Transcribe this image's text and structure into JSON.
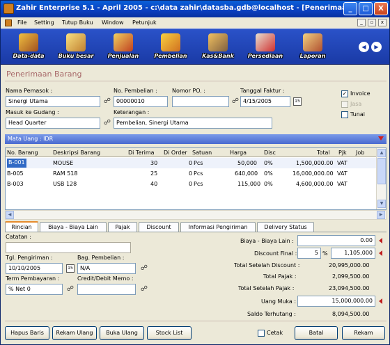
{
  "window": {
    "title": "Zahir Enterprise 5.1 - April 2005 - c:\\data zahir\\datasba.gdb@localhost - [Penerimaa..."
  },
  "titlebar_buttons": {
    "minimize": "_",
    "maximize": "□",
    "close": "X"
  },
  "menu": [
    "File",
    "Setting",
    "Tutup Buku",
    "Window",
    "Petunjuk"
  ],
  "mdi_controls": {
    "minimize": "_",
    "restore": "▫",
    "close": "x"
  },
  "toolbar": {
    "items": [
      "Data-data",
      "Buku besar",
      "Penjualan",
      "Pembelian",
      "Kas&Bank",
      "Persediaan",
      "Laporan"
    ],
    "prev": "◀",
    "next": "▶"
  },
  "form": {
    "heading": "Penerimaan Barang",
    "nama_pemasok": {
      "label": "Nama Pemasok :",
      "value": "Sinergi Utama"
    },
    "no_pembelian": {
      "label": "No. Pembelian :",
      "value": "00000010"
    },
    "nomor_po": {
      "label": "Nomor PO. :",
      "value": ""
    },
    "tanggal_faktur": {
      "label": "Tanggal Faktur :",
      "value": "4/15/2005"
    },
    "masuk_ke_gudang": {
      "label": "Masuk ke Gudang :",
      "value": "Head Quarter"
    },
    "keterangan": {
      "label": "Keterangan :",
      "value": "Pembelian, Sinergi Utama"
    },
    "checks": {
      "invoice": {
        "label": "Invoice",
        "checked": true
      },
      "jasa": {
        "label": "Jasa",
        "checked": false
      },
      "tunai": {
        "label": "Tunai",
        "checked": false
      }
    },
    "cal_label": "15",
    "lookup_glyph": "☍"
  },
  "currency_bar": "Mata Uang : IDR",
  "grid": {
    "columns": [
      "No. Barang",
      "Deskripsi Barang",
      "Di Terima",
      "Di Order",
      "Satuan",
      "Harga",
      "Disc",
      "Total",
      "Pjk",
      "Job"
    ],
    "rows": [
      [
        "B-001",
        "MOUSE",
        "30",
        "0",
        "Pcs",
        "50,000",
        "0%",
        "1,500,000.00",
        "VAT",
        ""
      ],
      [
        "B-005",
        "RAM 518",
        "25",
        "0",
        "Pcs",
        "640,000",
        "0%",
        "16,000,000.00",
        "VAT",
        ""
      ],
      [
        "B-003",
        "USB 128",
        "40",
        "0",
        "Pcs",
        "115,000",
        "0%",
        "4,600,000.00",
        "VAT",
        ""
      ]
    ]
  },
  "tabs": [
    "Rincian",
    "Biaya - Biaya Lain",
    "Pajak",
    "Discount",
    "Informasi Pengiriman",
    "Delivery Status"
  ],
  "rincian": {
    "catatan": {
      "label": "Catatan :",
      "value": ""
    },
    "tgl_pengiriman": {
      "label": "Tgl. Pengiriman :",
      "value": "10/10/2005"
    },
    "bag_pembelian": {
      "label": "Bag. Pembelian :",
      "value": "N/A"
    },
    "term": {
      "label": "Term Pembayaran :",
      "value": "%  Net 0"
    },
    "credit_debit": {
      "label": "Credit/Debit Memo :",
      "value": ""
    }
  },
  "summary": {
    "biaya_lain": {
      "label": "Biaya - Biaya Lain :",
      "value": "0.00"
    },
    "discount_final": {
      "label": "Discount Final :",
      "pct": "5",
      "pct_sign": "%",
      "value": "1,105,000"
    },
    "total_setelah_discount": {
      "label": "Total Setelah Discount :",
      "value": "20,995,000.00"
    },
    "total_pajak": {
      "label": "Total Pajak :",
      "value": "2,099,500.00"
    },
    "total_setelah_pajak": {
      "label": "Total Setelah Pajak :",
      "value": "23,094,500.00"
    },
    "uang_muka": {
      "label": "Uang Muka :",
      "value": "15,000,000.00"
    },
    "saldo_terhutang": {
      "label": "Saldo Terhutang :",
      "value": "8,094,500.00"
    }
  },
  "buttons": {
    "hapus_baris": "Hapus Baris",
    "rekam_ulang": "Rekam Ulang",
    "buka_ulang": "Buka Ulang",
    "stock_list": "Stock List",
    "cetak": "Cetak",
    "batal": "Batal",
    "rekam": "Rekam"
  },
  "colors": {
    "title_bar": "#0a3fbf",
    "toolbar": "#1a3aa6",
    "heading": "#a86a6a",
    "accent_tab": "#e68b2c"
  }
}
